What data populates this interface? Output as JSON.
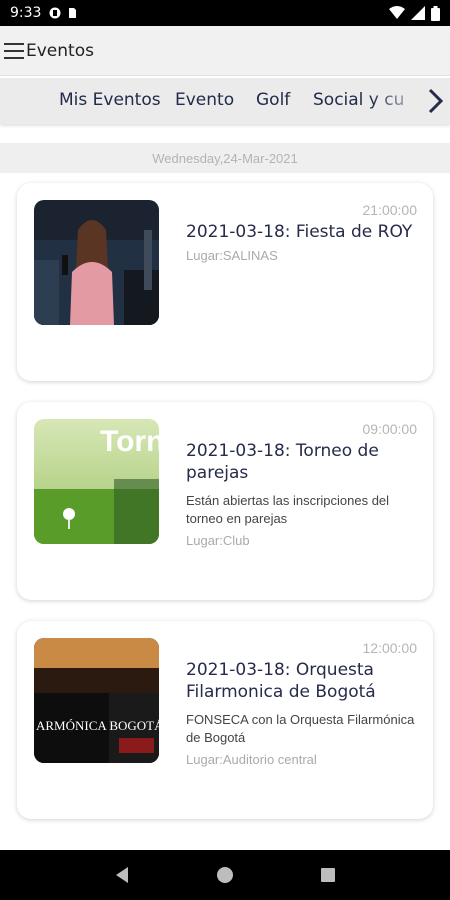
{
  "status_bar": {
    "time": "9:33"
  },
  "app_bar": {
    "title": "Eventos"
  },
  "tabs": [
    {
      "label": "Mis Eventos"
    },
    {
      "label": "Evento"
    },
    {
      "label": "Golf"
    },
    {
      "label": "Social y cu"
    }
  ],
  "date_header": "Wednesday,24-Mar-2021",
  "events": [
    {
      "time": "21:00:00",
      "title": "2021-03-18: Fiesta de ROY",
      "description": "",
      "place": "Lugar:SALINAS",
      "thumb_text": ""
    },
    {
      "time": "09:00:00",
      "title": "2021-03-18: Torneo de parejas",
      "description": "Están abiertas las inscripciones del torneo en parejas",
      "place": "Lugar:Club",
      "thumb_text": "Torneo parejas"
    },
    {
      "time": "12:00:00",
      "title": "2021-03-18: Orquesta Filarmonica de Bogotá",
      "description": "FONSECA con la Orquesta Filarmónica de Bogotá",
      "place": "Lugar:Auditorio central",
      "thumb_text": "ARMÓNICA BOGOTÁ"
    }
  ]
}
